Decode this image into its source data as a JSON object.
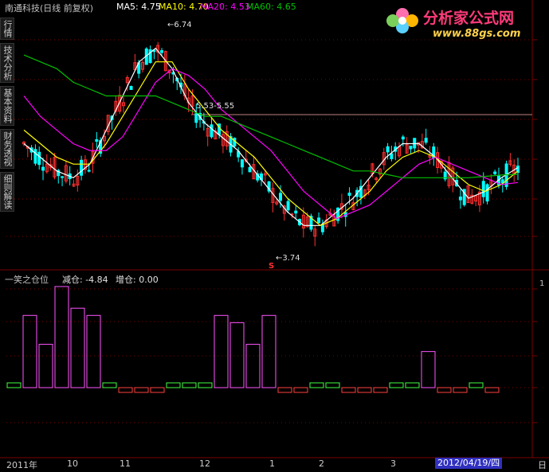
{
  "header": {
    "stock_title": "南通科技(日线 前复权)",
    "ma5": "MA5: 4.75",
    "ma10": "MA10: 4.70",
    "ma20": "MA20: 4.53",
    "ma60": "MA60: 4.65"
  },
  "side_tabs": [
    "行情",
    "技术分析",
    "基本资料",
    "财务透视",
    "细则解读"
  ],
  "logo": {
    "title": "分析家公式网",
    "url": "www.88gs.com"
  },
  "annotations": {
    "high_label": "6.74",
    "low_label": "3.74",
    "range_label": "5.53-5.55",
    "sell_marker": "S"
  },
  "indicator": {
    "name": "一笑之仓位",
    "reduce_label": "减仓: -4.84",
    "add_label": "增仓: 0.00"
  },
  "right_axis": {
    "label": "1"
  },
  "bottom_axis": {
    "labels": [
      "2011年",
      "10",
      "11",
      "12",
      "1",
      "2",
      "3"
    ],
    "date_badge": "2012/04/19/四",
    "right_label": "日"
  },
  "colors": {
    "up": "#ff3030",
    "down": "#00ffff",
    "ma5": "#ffffff",
    "ma10": "#ffff00",
    "ma20": "#ff00ff",
    "ma60": "#00c000",
    "grid": "#7a0000",
    "hist_up": "#ff55ff",
    "hist_flat": "#40ff40",
    "hist_down": "#ff4040"
  },
  "chart_data": {
    "type": "line",
    "series": [
      {
        "name": "MA5",
        "values": [
          5.1,
          4.9,
          4.7,
          4.6,
          4.8,
          5.3,
          5.8,
          6.3,
          6.5,
          6.2,
          5.7,
          5.4,
          5.2,
          5.0,
          4.7,
          4.4,
          4.1,
          3.9,
          3.9,
          4.1,
          4.3,
          4.6,
          4.9,
          5.1,
          5.1,
          4.9,
          4.6,
          4.3,
          4.4,
          4.6,
          4.75
        ]
      },
      {
        "name": "MA10",
        "values": [
          5.3,
          5.1,
          4.9,
          4.8,
          4.8,
          5.1,
          5.5,
          5.9,
          6.3,
          6.3,
          5.9,
          5.6,
          5.3,
          5.1,
          4.9,
          4.6,
          4.3,
          4.1,
          3.9,
          4.0,
          4.2,
          4.4,
          4.7,
          4.9,
          5.0,
          4.9,
          4.7,
          4.5,
          4.4,
          4.5,
          4.7
        ]
      },
      {
        "name": "MA20",
        "values": [
          5.8,
          5.5,
          5.3,
          5.1,
          5.0,
          5.0,
          5.2,
          5.6,
          6.0,
          6.2,
          6.1,
          5.9,
          5.6,
          5.4,
          5.2,
          5.0,
          4.7,
          4.4,
          4.2,
          4.0,
          4.1,
          4.2,
          4.4,
          4.6,
          4.8,
          4.9,
          4.8,
          4.7,
          4.6,
          4.5,
          4.53
        ]
      },
      {
        "name": "MA60",
        "values": [
          6.4,
          6.3,
          6.2,
          6.0,
          5.9,
          5.8,
          5.8,
          5.8,
          5.8,
          5.7,
          5.6,
          5.5,
          5.5,
          5.4,
          5.3,
          5.2,
          5.1,
          5.0,
          4.9,
          4.8,
          4.7,
          4.7,
          4.65,
          4.6,
          4.6,
          4.6,
          4.6,
          4.6,
          4.62,
          4.64,
          4.65
        ]
      }
    ],
    "indicator_values": [
      0.1,
      1.0,
      0.6,
      1.4,
      1.1,
      1.0,
      0.1,
      -0.05,
      -0.1,
      -0.1,
      0.1,
      0.1,
      0.0,
      1.0,
      0.9,
      0.6,
      1.0,
      -0.1,
      -0.05,
      0.05,
      0.0,
      -0.05,
      -0.1,
      -0.1,
      0.05,
      0.1,
      0.5,
      -0.05,
      -0.05,
      0.0,
      -0.05
    ],
    "annotations": {
      "high": 6.74,
      "low": 3.74,
      "range": "5.53-5.55"
    },
    "date_labels": [
      "2011年",
      "10",
      "11",
      "12",
      "1",
      "2",
      "3"
    ]
  }
}
